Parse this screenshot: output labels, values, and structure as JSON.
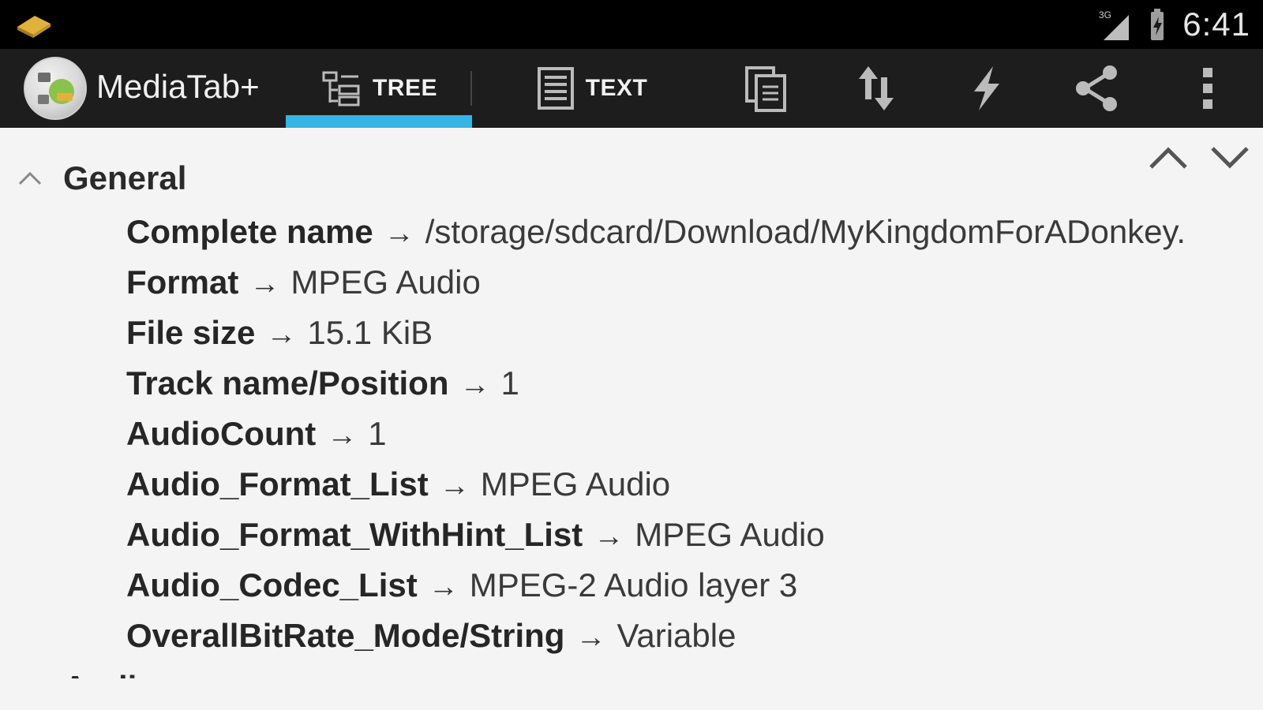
{
  "status_bar": {
    "time": "6:41",
    "network": "3G",
    "icons": [
      "notification-icon",
      "signal-icon",
      "battery-icon"
    ]
  },
  "action_bar": {
    "app_title": "MediaTab+",
    "tabs": [
      {
        "label": "TREE",
        "icon": "tree-icon",
        "selected": true
      },
      {
        "label": "TEXT",
        "icon": "text-list-icon",
        "selected": false
      }
    ],
    "actions": [
      "copy-icon",
      "sort-icon",
      "flash-icon",
      "share-icon",
      "overflow-menu-icon"
    ],
    "accent_color": "#33b5e5"
  },
  "content": {
    "section": {
      "title": "General",
      "expanded": true
    },
    "arrow": "→",
    "rows": [
      {
        "key": "Complete name",
        "value": "/storage/sdcard/Download/MyKingdomForADonkey."
      },
      {
        "key": "Format",
        "value": "MPEG Audio"
      },
      {
        "key": "File size",
        "value": "15.1 KiB"
      },
      {
        "key": "Track name/Position",
        "value": "1"
      },
      {
        "key": "AudioCount",
        "value": "1"
      },
      {
        "key": "Audio_Format_List",
        "value": "MPEG Audio"
      },
      {
        "key": "Audio_Format_WithHint_List",
        "value": "MPEG Audio"
      },
      {
        "key": "Audio_Codec_List",
        "value": "MPEG-2 Audio layer 3"
      },
      {
        "key": "OverallBitRate_Mode/String",
        "value": "Variable"
      }
    ],
    "next_section": "Audio"
  }
}
